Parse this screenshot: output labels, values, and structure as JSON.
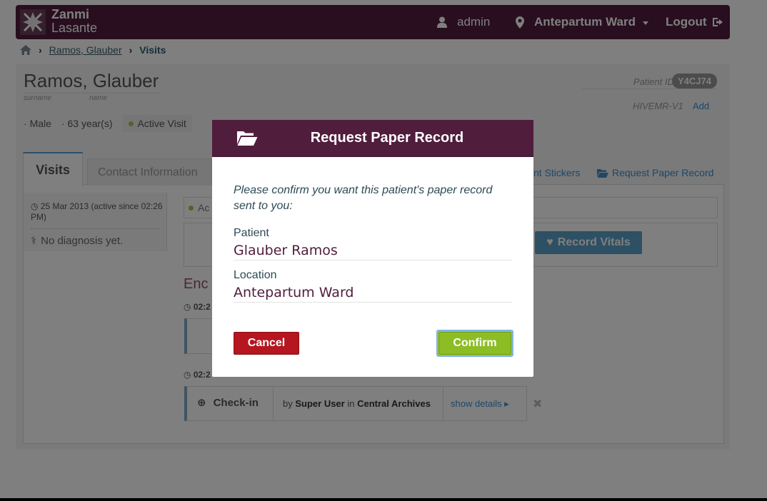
{
  "header": {
    "logo_line1": "Zanmi",
    "logo_line2": "Lasante",
    "user": "admin",
    "location": "Antepartum Ward",
    "logout": "Logout",
    "bg_color": "#501d3d"
  },
  "breadcrumb": {
    "patient": "Ramos, Glauber",
    "current": "Visits"
  },
  "patient": {
    "name": "Ramos, Glauber",
    "surname_label": "surname",
    "name_label": "name",
    "gender": "Male",
    "age": "63 year(s)",
    "active_visit": "Active Visit",
    "patient_id_label": "Patient ID",
    "patient_id": "Y4CJ74",
    "hivemr_label": "HIVEMR-V1",
    "add_link": "Add"
  },
  "tabs": {
    "visits": "Visits",
    "contact": "Contact Information",
    "stickers_link": "nt Stickers",
    "request_paper_link": "Request Paper Record"
  },
  "visit_list": {
    "date": "25 Mar 2013 (active since 02:26 PM)",
    "diagnosis": "No diagnosis yet."
  },
  "main": {
    "active_prefix": "Ac",
    "record_vitals": "Record Vitals",
    "encounters_title": "Enc",
    "time1": "02:2",
    "time2": "02:2",
    "checkin_title": "Check-in",
    "checkin_by_prefix": "by",
    "checkin_user": "Super User",
    "checkin_in": "in",
    "checkin_location": "Central Archives",
    "show_details": "show details"
  },
  "modal": {
    "title": "Request Paper Record",
    "message": "Please confirm you want this patient's paper record sent to you:",
    "patient_label": "Patient",
    "patient_value": "Glauber Ramos",
    "location_label": "Location",
    "location_value": "Antepartum Ward",
    "cancel": "Cancel",
    "confirm": "Confirm"
  }
}
